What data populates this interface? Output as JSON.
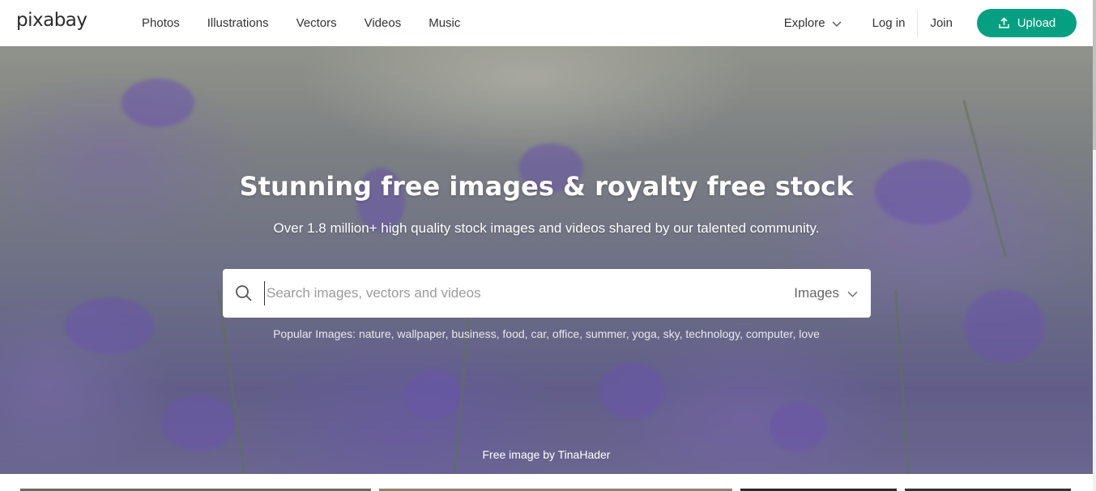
{
  "header": {
    "logo": "pixabay",
    "nav": [
      "Photos",
      "Illustrations",
      "Vectors",
      "Videos",
      "Music"
    ],
    "explore_label": "Explore",
    "login_label": "Log in",
    "join_label": "Join",
    "upload_label": "Upload"
  },
  "hero": {
    "title": "Stunning free images & royalty free stock",
    "subtitle": "Over 1.8 million+ high quality stock images and videos shared by our talented community.",
    "search": {
      "placeholder": "Search images, vectors and videos",
      "type_selected": "Images"
    },
    "popular": {
      "prefix": "Popular Images:",
      "tags": [
        "nature",
        "wallpaper",
        "business",
        "food",
        "car",
        "office",
        "summer",
        "yoga",
        "sky",
        "technology",
        "computer",
        "love"
      ]
    },
    "credit": {
      "prefix": "Free image by",
      "author": "TinaHader"
    }
  },
  "colors": {
    "brand_green": "#05a081",
    "hero_purple": "#7c6fb0"
  },
  "icons": [
    "upload-icon",
    "chevron-down-icon",
    "search-icon"
  ]
}
